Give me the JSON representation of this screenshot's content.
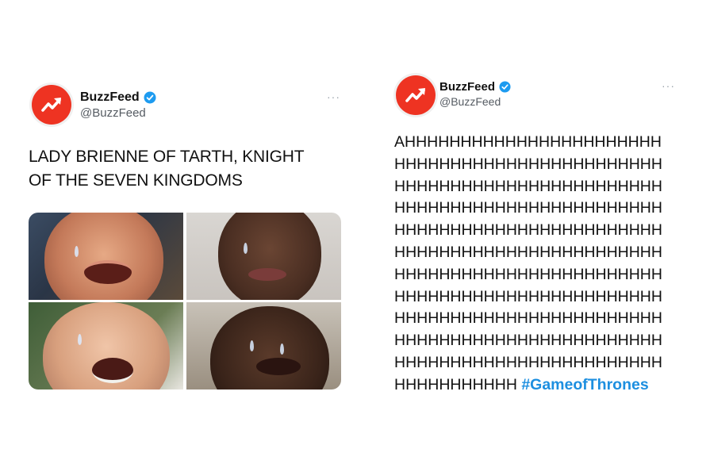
{
  "tweets": [
    {
      "display_name": "BuzzFeed",
      "handle": "@BuzzFeed",
      "more_label": "···",
      "text_lines": [
        "LADY BRIENNE OF TARTH, KNIGHT",
        "OF THE SEVEN KINGDOMS"
      ],
      "media": [
        "crying-face",
        "crying-face",
        "crying-face",
        "crying-face"
      ]
    },
    {
      "display_name": "BuzzFeed",
      "handle": "@BuzzFeed",
      "more_label": "···",
      "text": "AHHHHHHHHHHHHHHHHHHHHHHH\nHHHHHHHHHHHHHHHHHHHHHHHH\nHHHHHHHHHHHHHHHHHHHHHHHH\nHHHHHHHHHHHHHHHHHHHHHHHH\nHHHHHHHHHHHHHHHHHHHHHHHH\nHHHHHHHHHHHHHHHHHHHHHHHH\nHHHHHHHHHHHHHHHHHHHHHHHH\nHHHHHHHHHHHHHHHHHHHHHHHH\nHHHHHHHHHHHHHHHHHHHHHHHH\nHHHHHHHHHHHHHHHHHHHHHHHH\nHHHHHHHHHHHHHHHHHHHHHHHH\nHHHHHHHHHHH ",
      "hashtag": "#GameofThrones"
    }
  ],
  "colors": {
    "brand_red": "#ee3322",
    "verified_blue": "#1d9bf0",
    "hashtag_blue": "#1d8fe0",
    "handle_gray": "#555b62"
  },
  "icons": {
    "avatar": "buzzfeed-trending-arrow-icon",
    "verified": "verified-badge-icon",
    "more": "more-options-icon"
  }
}
